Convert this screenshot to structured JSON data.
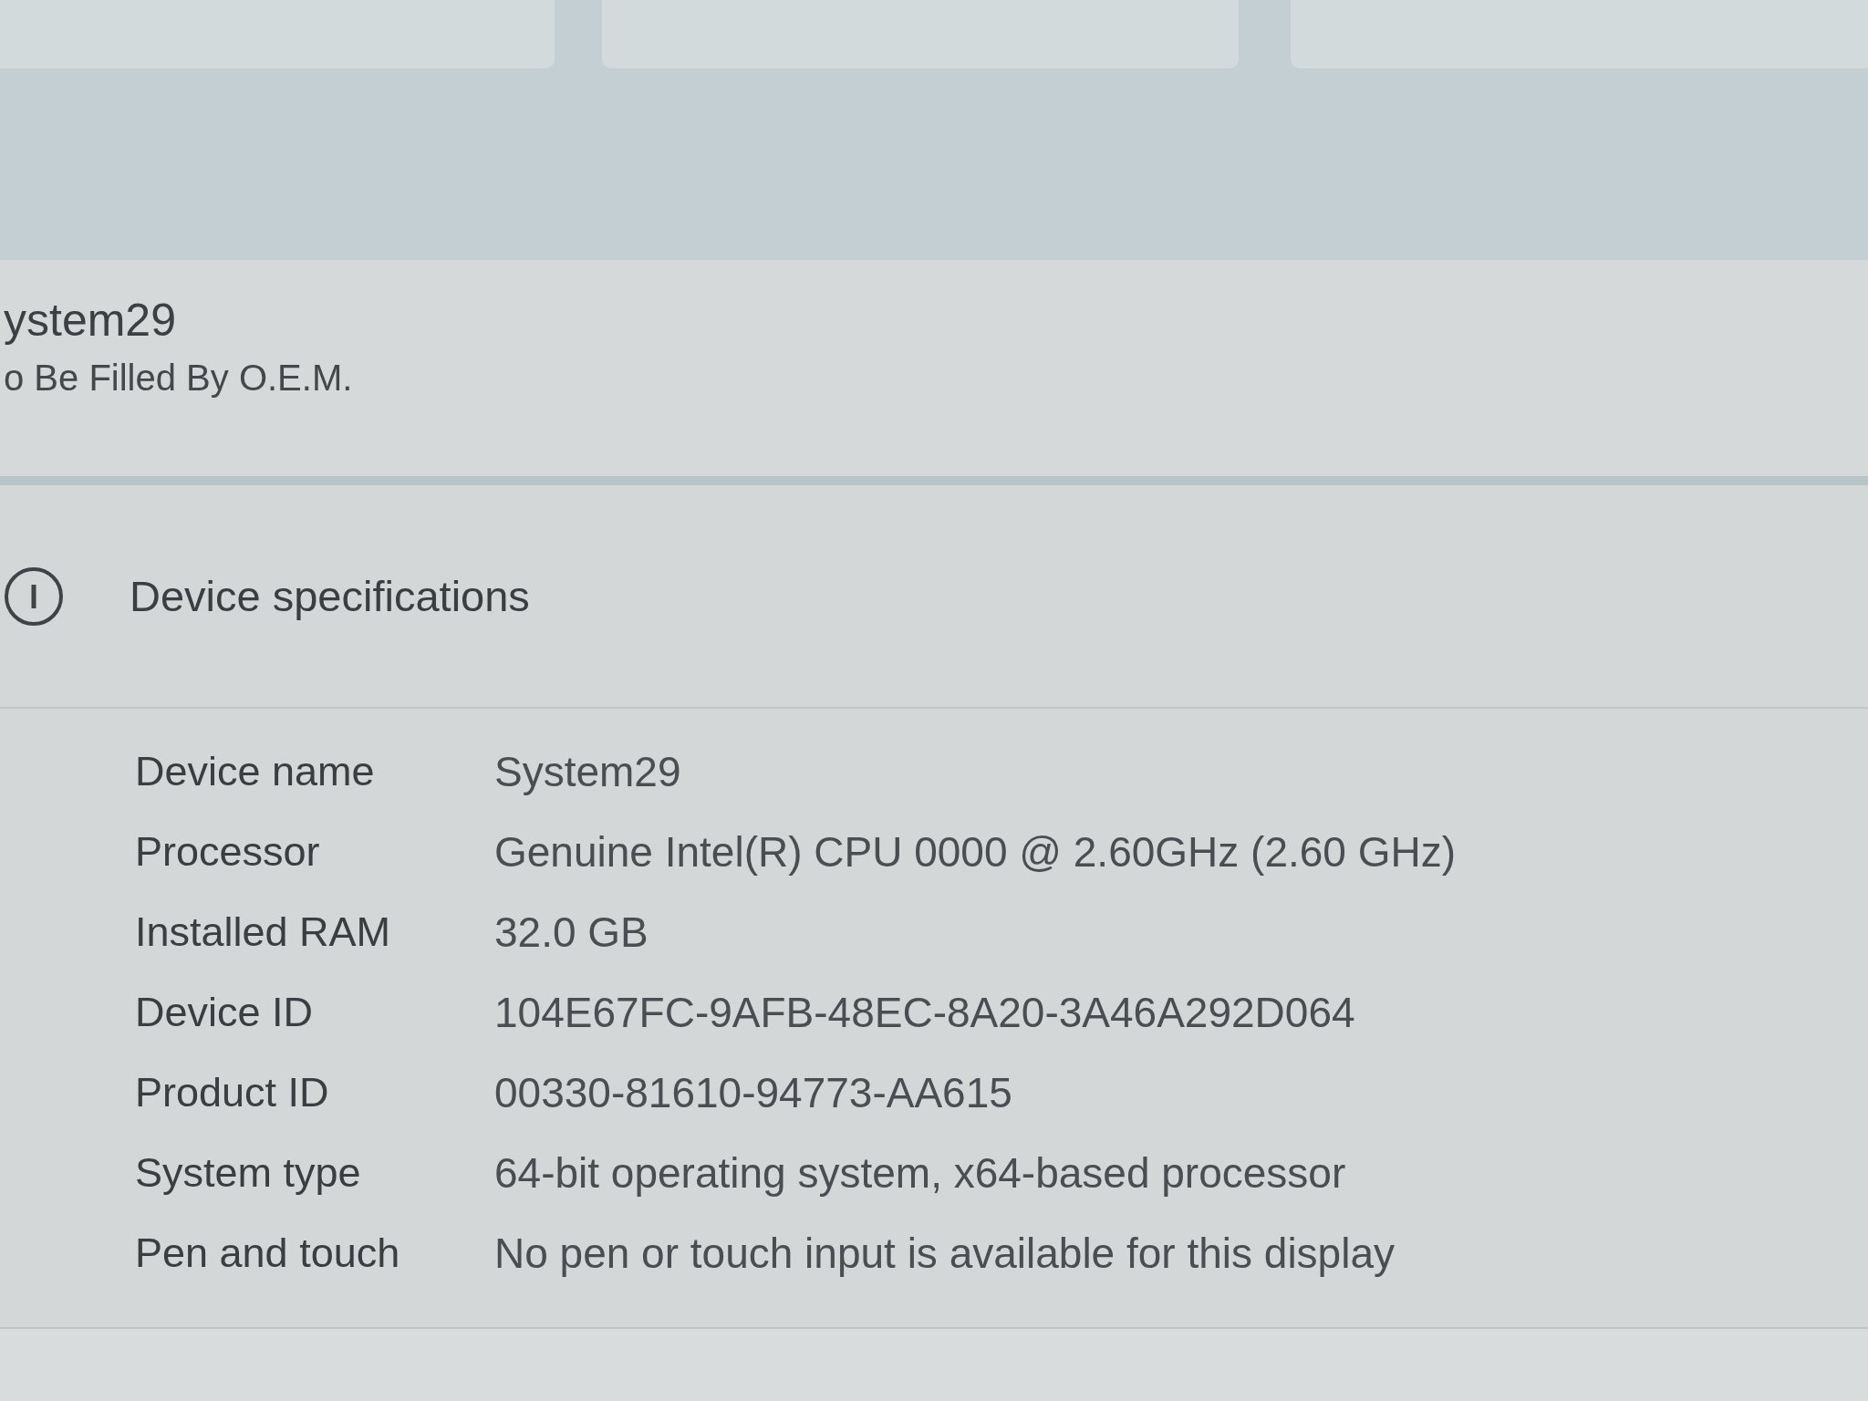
{
  "device_header": {
    "name": "ystem29",
    "model": "o Be Filled By O.E.M."
  },
  "device_specifications": {
    "title": "Device specifications",
    "rows": [
      {
        "label": "Device name",
        "value": "System29"
      },
      {
        "label": "Processor",
        "value": "Genuine Intel(R) CPU 0000 @ 2.60GHz (2.60 GHz)"
      },
      {
        "label": "Installed RAM",
        "value": "32.0 GB"
      },
      {
        "label": "Device ID",
        "value": "104E67FC-9AFB-48EC-8A20-3A46A292D064"
      },
      {
        "label": "Product ID",
        "value": "00330-81610-94773-AA615"
      },
      {
        "label": "System type",
        "value": "64-bit operating system, x64-based processor"
      },
      {
        "label": "Pen and touch",
        "value": "No pen or touch input is available for this display"
      }
    ]
  }
}
